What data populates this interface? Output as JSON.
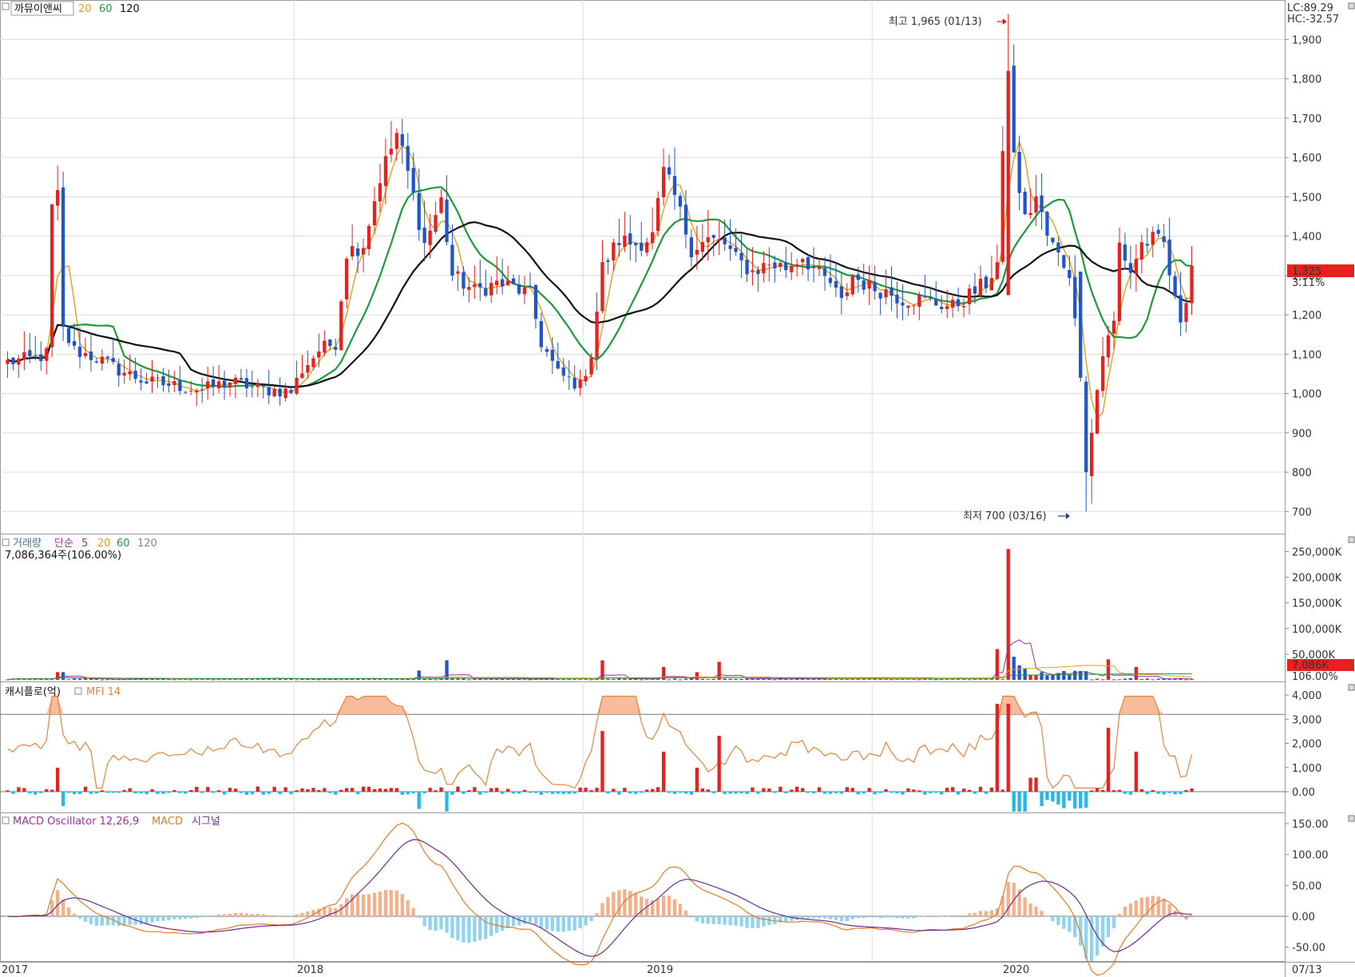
{
  "colors": {
    "up": "#e8201e",
    "down": "#1f55c8",
    "ma20": "#e3a11a",
    "ma60": "#1f9a3c",
    "ma120": "#111111",
    "mfi": "#e3843d",
    "cash_up": "#e8201e",
    "cash_down": "#23b8e8",
    "macd_line": "#e07b2b",
    "signal_line": "#6b2c91",
    "osc_pos": "#f4b08a",
    "osc_neg": "#8fd3ee",
    "grid": "#dcdcdc",
    "frame": "#9a9a9a"
  },
  "price_panel": {
    "title": "까뮤이앤씨",
    "ma_labels": [
      "20",
      "60",
      "120"
    ],
    "lc_label": "LC:89.29",
    "hc_label": "HC:-32.57",
    "current_price": "1,325",
    "current_change": "3.11%",
    "high_annotation": "최고 1,965 (01/13)",
    "low_annotation": "최저 700 (03/16)",
    "y_ticks": [
      "1,900",
      "1,800",
      "1,700",
      "1,600",
      "1,500",
      "1,400",
      "1,300",
      "1,200",
      "1,100",
      "1,000",
      "900",
      "800",
      "700"
    ]
  },
  "volume_panel": {
    "title": "거래량",
    "ma_type": "단순",
    "ma_labels": [
      "5",
      "20",
      "60",
      "120"
    ],
    "info": "7,086,364주(106.00%)",
    "current_volume": "7,086K",
    "current_pct": "106.00%",
    "y_ticks": [
      "250,000K",
      "200,000K",
      "150,000K",
      "100,000K",
      "50,000K"
    ]
  },
  "cash_panel": {
    "title": "캐시플로(억)",
    "indicator": "MFI 14",
    "y_ticks": [
      "4,000",
      "3,000",
      "2,000",
      "1,000",
      "0.00"
    ]
  },
  "macd_panel": {
    "title": "MACD Oscillator 12,26,9",
    "macd_label": "MACD",
    "signal_label": "시그널",
    "y_ticks": [
      "150.00",
      "100.00",
      "50.00",
      "0.00",
      "-50.00"
    ]
  },
  "x_axis": {
    "labels": [
      "2017",
      "2018",
      "2019",
      "2020",
      "07/13"
    ]
  },
  "chart_data": {
    "type": "candlestick",
    "period": "weekly",
    "years": [
      "2017",
      "2018",
      "2019",
      "2020"
    ],
    "last_label": "07/13",
    "price_range": [
      660,
      1980
    ],
    "high": 1965,
    "low": 700,
    "last_close": 1325,
    "anchors": [
      [
        0,
        1080
      ],
      [
        5,
        1090
      ],
      [
        7,
        1100
      ],
      [
        8,
        1470
      ],
      [
        9,
        1500
      ],
      [
        10,
        1160
      ],
      [
        12,
        1110
      ],
      [
        16,
        1090
      ],
      [
        20,
        1060
      ],
      [
        25,
        1030
      ],
      [
        30,
        1020
      ],
      [
        35,
        1010
      ],
      [
        40,
        1030
      ],
      [
        46,
        1010
      ],
      [
        51,
        1005
      ],
      [
        53,
        1060
      ],
      [
        56,
        1110
      ],
      [
        59,
        1130
      ],
      [
        61,
        1360
      ],
      [
        64,
        1380
      ],
      [
        67,
        1550
      ],
      [
        70,
        1660
      ],
      [
        72,
        1560
      ],
      [
        75,
        1380
      ],
      [
        78,
        1490
      ],
      [
        80,
        1300
      ],
      [
        84,
        1260
      ],
      [
        88,
        1280
      ],
      [
        91,
        1270
      ],
      [
        94,
        1250
      ],
      [
        96,
        1130
      ],
      [
        99,
        1050
      ],
      [
        103,
        1020
      ],
      [
        105,
        1100
      ],
      [
        107,
        1320
      ],
      [
        110,
        1390
      ],
      [
        113,
        1380
      ],
      [
        116,
        1400
      ],
      [
        118,
        1560
      ],
      [
        120,
        1500
      ],
      [
        123,
        1370
      ],
      [
        126,
        1390
      ],
      [
        129,
        1380
      ],
      [
        131,
        1340
      ],
      [
        134,
        1310
      ],
      [
        137,
        1330
      ],
      [
        140,
        1320
      ],
      [
        143,
        1350
      ],
      [
        146,
        1300
      ],
      [
        148,
        1280
      ],
      [
        150,
        1230
      ],
      [
        152,
        1300
      ],
      [
        155,
        1270
      ],
      [
        158,
        1260
      ],
      [
        161,
        1240
      ],
      [
        164,
        1240
      ],
      [
        167,
        1230
      ],
      [
        170,
        1220
      ],
      [
        173,
        1250
      ],
      [
        176,
        1280
      ],
      [
        178,
        1330
      ],
      [
        180,
        1850
      ],
      [
        181,
        1600
      ],
      [
        183,
        1440
      ],
      [
        185,
        1500
      ],
      [
        187,
        1400
      ],
      [
        189,
        1350
      ],
      [
        191,
        1310
      ],
      [
        193,
        1050
      ],
      [
        194,
        800
      ],
      [
        195,
        900
      ],
      [
        196,
        1010
      ],
      [
        197,
        1100
      ],
      [
        199,
        1180
      ],
      [
        200,
        1380
      ],
      [
        202,
        1310
      ],
      [
        204,
        1380
      ],
      [
        206,
        1390
      ],
      [
        208,
        1380
      ],
      [
        210,
        1230
      ],
      [
        211,
        1190
      ],
      [
        212,
        1250
      ],
      [
        213,
        1325
      ]
    ],
    "volume_spikes": [
      [
        9,
        15000
      ],
      [
        10,
        15000
      ],
      [
        74,
        18000
      ],
      [
        79,
        38000
      ],
      [
        107,
        38000
      ],
      [
        118,
        25000
      ],
      [
        124,
        15000
      ],
      [
        128,
        35000
      ],
      [
        178,
        60000
      ],
      [
        180,
        255000
      ],
      [
        181,
        45000
      ],
      [
        182,
        28000
      ],
      [
        183,
        22000
      ],
      [
        186,
        15000
      ],
      [
        198,
        40000
      ],
      [
        203,
        25000
      ]
    ],
    "ma_labels": [
      "20",
      "60",
      "120"
    ]
  }
}
